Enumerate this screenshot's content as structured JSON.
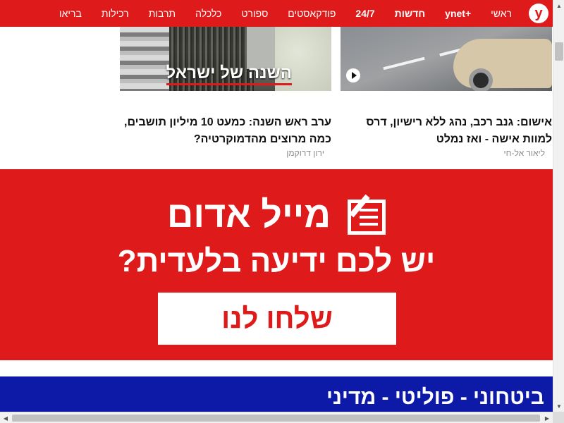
{
  "nav": {
    "logo": "y",
    "items": [
      "ראשי",
      "+ynet",
      "חדשות",
      "24/7",
      "פודקאסטים",
      "ספורט",
      "כלכלה",
      "תרבות",
      "רכילות",
      "בריאו"
    ]
  },
  "articles": [
    {
      "headline": "אישום: גנב רכב, נהג ללא רישיון, דרס למוות אישה - ואז נמלט",
      "author": "ליאור אל-חי",
      "has_video": true
    },
    {
      "headline": "ערב ראש השנה: כמעט 10 מיליון תושבים, כמה מרוצים מהדמוקרטיה?",
      "author": "ירון דרוקמן",
      "image_caption": "השנה של ישראל"
    }
  ],
  "banner": {
    "title": "מייל אדום",
    "subtitle": "יש לכם ידיעה בלעדית?",
    "button": "שלחו לנו"
  },
  "section": {
    "title": "ביטחוני - פוליטי - מדיני"
  },
  "colors": {
    "brand_red": "#de1a1a",
    "section_blue": "#0d1aa8"
  },
  "icons": {
    "play": "play-icon",
    "mail": "edit-mail-icon"
  }
}
